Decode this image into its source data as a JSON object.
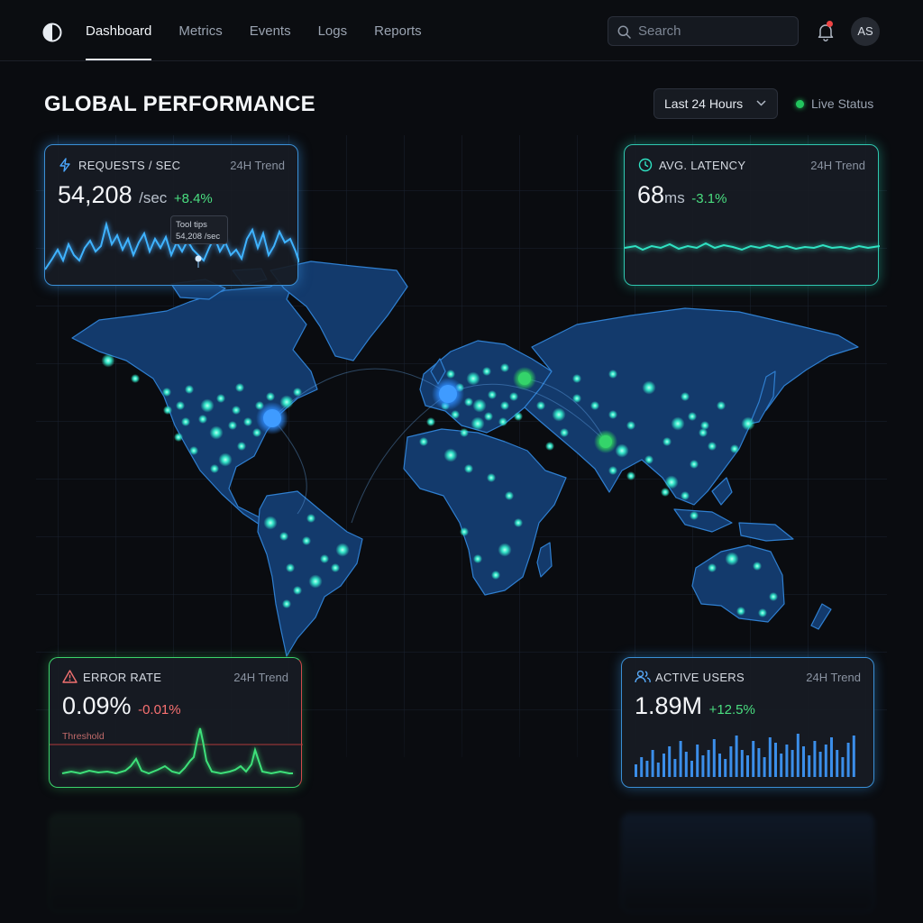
{
  "nav": {
    "items": [
      {
        "label": "Dashboard",
        "active": true
      },
      {
        "label": "Metrics",
        "active": false
      },
      {
        "label": "Events",
        "active": false
      },
      {
        "label": "Logs",
        "active": false
      },
      {
        "label": "Reports",
        "active": false
      }
    ],
    "search_placeholder": "Search",
    "notification_badge": true,
    "avatar_initials": "AS",
    "icons": {
      "logo": "half-circle-logo-icon",
      "search": "search-icon",
      "bell": "bell-icon"
    }
  },
  "header": {
    "title": "GLOBAL PERFORMANCE",
    "time_range": "Last 24 Hours",
    "live_status": "Live Status"
  },
  "cards": {
    "requests": {
      "title": "REQUESTS / SEC",
      "trend_label": "24H Trend",
      "value": "54,208",
      "unit": "/sec",
      "delta": "+8.4%",
      "icon": "lightning-icon",
      "tooltip_title": "Tool tips",
      "tooltip_value": "54,208 /sec",
      "accent": "#3fa9ff"
    },
    "latency": {
      "title": "AVG. LATENCY",
      "trend_label": "24H Trend",
      "value": "68",
      "unit": "ms",
      "delta": "-3.1%",
      "icon": "clock-icon",
      "accent": "#2fe3c3"
    },
    "errors": {
      "title": "ERROR RATE",
      "trend_label": "24H Trend",
      "value": "0.09%",
      "delta": "-0.01%",
      "threshold_label": "Threshold",
      "icon": "warning-icon",
      "accent": "#34d46a"
    },
    "users": {
      "title": "ACTIVE USERS",
      "trend_label": "24H Trend",
      "value": "1.89M",
      "delta": "+12.5%",
      "icon": "users-icon",
      "accent": "#3fa9ff"
    }
  },
  "colors": {
    "background": "#0a0c10",
    "map_land": "#123a6b",
    "city_glow": "#3cf0d0",
    "hub_blue": "#3f9bff",
    "hub_green": "#34d46a",
    "positive": "#4ade80",
    "negative": "#f87171"
  }
}
